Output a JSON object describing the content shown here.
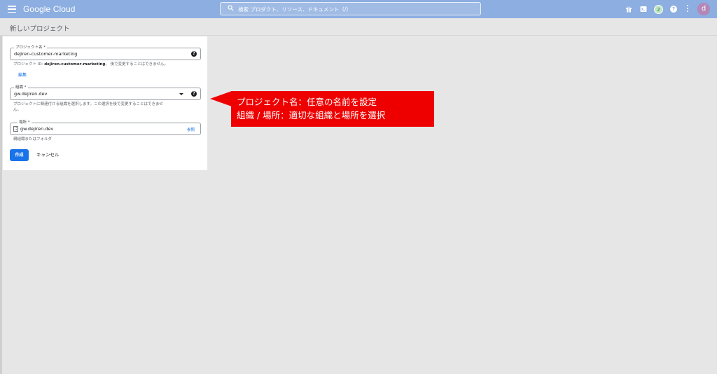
{
  "topbar": {
    "logo": "Google Cloud",
    "search_placeholder": "検索 プロダクト、リソース、ドキュメント（/）",
    "badge_count": "2",
    "help_glyph": "?",
    "avatar_letter": "d",
    "bg_color": "#8caee0"
  },
  "page": {
    "title": "新しいプロジェクト"
  },
  "form": {
    "project_name": {
      "label": "プロジェクト名 *",
      "value": "dejiren-customer-marketing",
      "helper_prefix": "プロジェクト ID: ",
      "helper_id": "dejiren-customer-marketing",
      "helper_suffix": "。 後で変更することはできません。",
      "edit_link": "編集"
    },
    "organization": {
      "label": "組織 *",
      "value": "gw.dejiren.dev",
      "helper_line1": "プロジェクトに関連付ける組織を選択します。この選択を後で変更することはできませ",
      "helper_line2": "ん。"
    },
    "location": {
      "label": "場所 *",
      "value": "gw.dejiren.dev",
      "browse": "参照",
      "helper": "親組織またはフォルダ"
    },
    "create_button": "作成",
    "cancel_button": "キャンセル",
    "accent_color": "#1a73e8"
  },
  "callout": {
    "line1": "プロジェクト名：任意の名前を設定",
    "line2": "組織 / 場所：適切な組織と場所を選択",
    "color": "#ee0000"
  },
  "icons": [
    "menu-icon",
    "search-icon",
    "gift-icon",
    "terminal-icon",
    "help-icon",
    "more-vert-icon",
    "building-icon",
    "dropdown-caret-icon"
  ]
}
